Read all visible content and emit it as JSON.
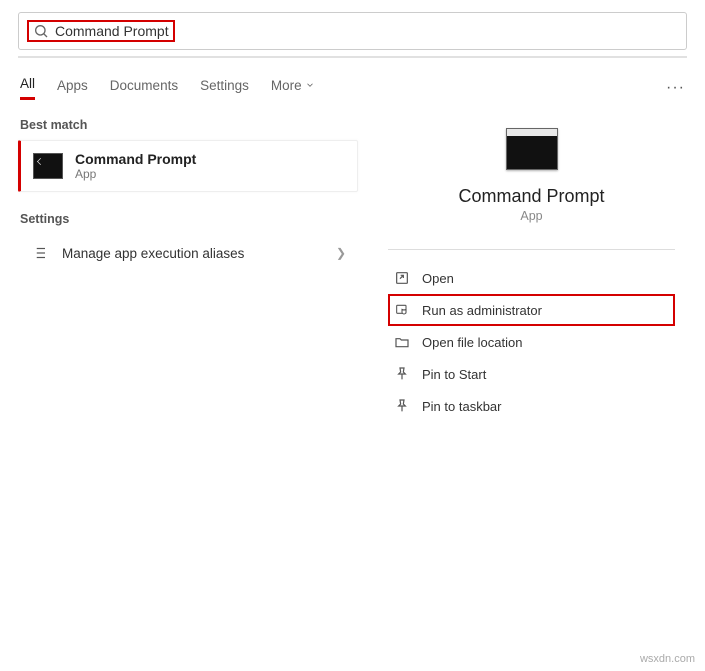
{
  "search": {
    "query": "Command Prompt"
  },
  "tabs": {
    "all": "All",
    "apps": "Apps",
    "documents": "Documents",
    "settings": "Settings",
    "more": "More"
  },
  "left": {
    "best_match_label": "Best match",
    "result": {
      "title": "Command Prompt",
      "subtitle": "App"
    },
    "settings_label": "Settings",
    "settings_item": "Manage app execution aliases"
  },
  "right": {
    "title": "Command Prompt",
    "subtitle": "App",
    "actions": {
      "open": "Open",
      "run_admin": "Run as administrator",
      "open_location": "Open file location",
      "pin_start": "Pin to Start",
      "pin_taskbar": "Pin to taskbar"
    }
  },
  "watermark": "wsxdn.com"
}
